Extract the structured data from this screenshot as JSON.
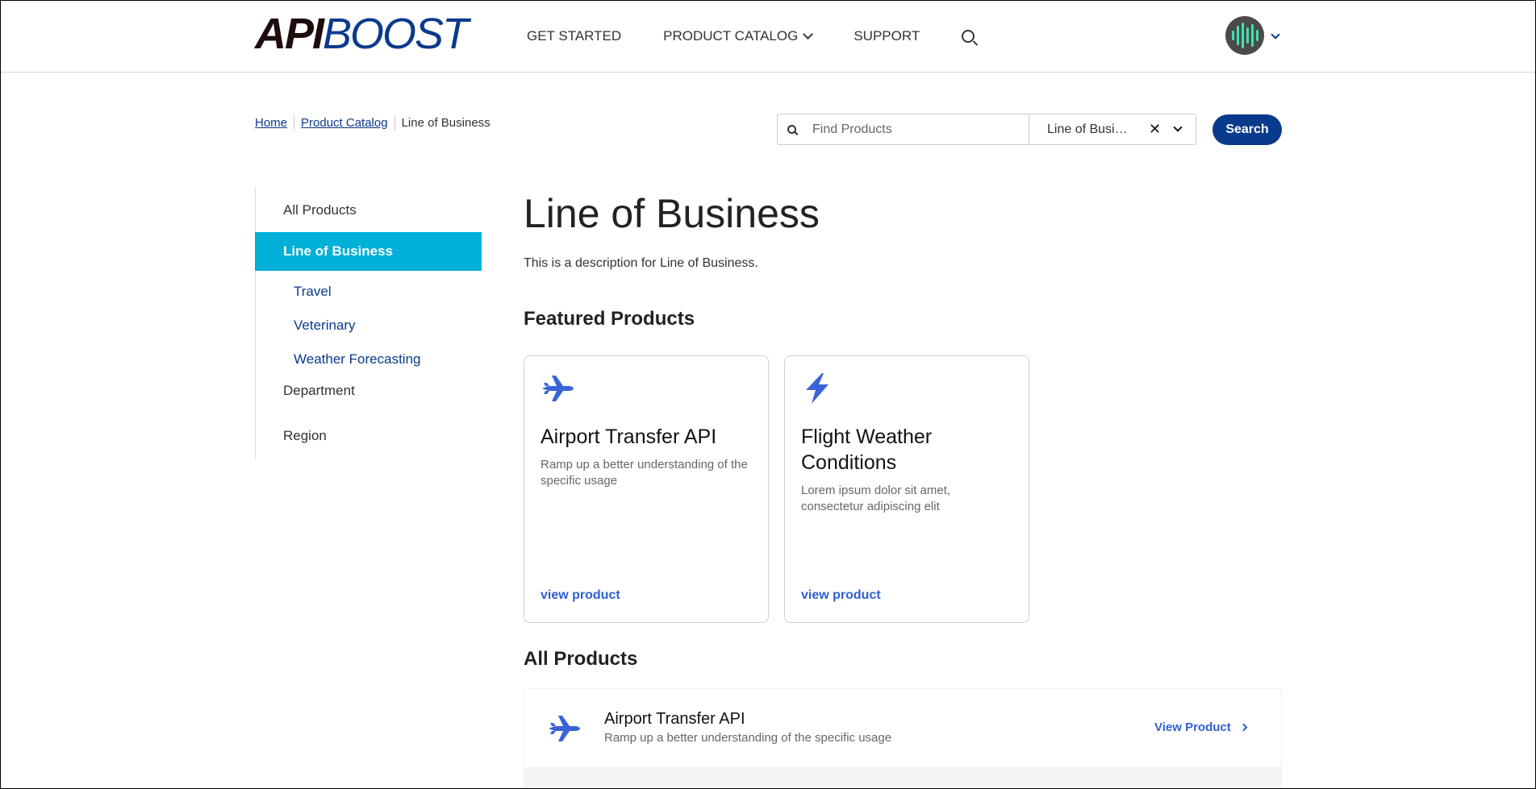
{
  "brand": {
    "logo_part1": "API",
    "logo_part2": "BOOST"
  },
  "nav": {
    "get_started": "GET STARTED",
    "product_catalog": "PRODUCT CATALOG",
    "support": "SUPPORT"
  },
  "breadcrumb": {
    "home": "Home",
    "product_catalog": "Product Catalog",
    "current": "Line of Business"
  },
  "search": {
    "placeholder": "Find Products",
    "filter_value": "Line of Business",
    "button_label": "Search"
  },
  "sidebar": {
    "all_products": "All Products",
    "line_of_business": "Line of Business",
    "sub_items": [
      "Travel",
      "Veterinary",
      "Weather Forecasting"
    ],
    "department": "Department",
    "region": "Region"
  },
  "main": {
    "title": "Line of Business",
    "description": "This is a description for Line of Business.",
    "featured_heading": "Featured Products",
    "all_products_heading": "All Products"
  },
  "featured": [
    {
      "icon": "airplane-icon",
      "title": "Airport Transfer API",
      "description": "Ramp up a better understanding of the specific usage",
      "link": "view product"
    },
    {
      "icon": "lightning-icon",
      "title": "Flight Weather Conditions",
      "description": "Lorem ipsum dolor sit amet, consectetur adipiscing elit",
      "link": "view product"
    }
  ],
  "products": [
    {
      "icon": "airplane-icon",
      "title": "Airport Transfer API",
      "description": "Ramp up a better understanding of the specific usage",
      "link": "View Product"
    }
  ],
  "colors": {
    "brand_navy": "#0a3a8c",
    "accent_cyan": "#00b0d8",
    "link_blue": "#2f5fd0",
    "icon_blue": "#3a63d8"
  }
}
